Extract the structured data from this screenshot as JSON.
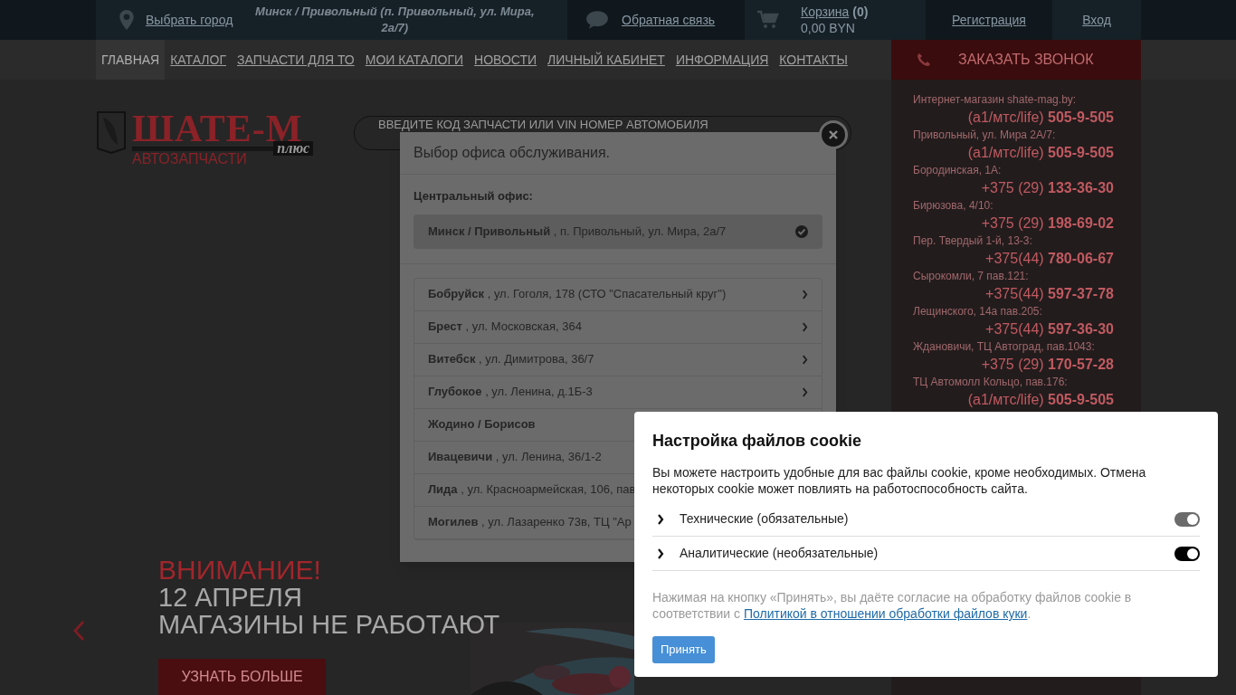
{
  "top_bar": {
    "city_link": "Выбрать город",
    "current_office": "Минск / Привольный (п. Привольный, ул. Мира, 2а/7)",
    "feedback_link": "Обратная связь",
    "cart": {
      "label": "Корзина",
      "count": "(0)",
      "total": "0,00 BYN"
    },
    "register_link": "Регистрация",
    "login_link": "Вход"
  },
  "nav": {
    "items": [
      {
        "label": "ГЛАВНАЯ",
        "selected": true
      },
      {
        "label": "КАТАЛОГ",
        "selected": false
      },
      {
        "label": "ЗАПЧАСТИ ДЛЯ ТО",
        "selected": false
      },
      {
        "label": "МОИ КАТАЛОГИ",
        "selected": false
      },
      {
        "label": "НОВОСТИ",
        "selected": false
      },
      {
        "label": "ЛИЧНЫЙ КАБИНЕТ",
        "selected": false
      },
      {
        "label": "ИНФОРМАЦИЯ",
        "selected": false
      },
      {
        "label": "КОНТАКТЫ",
        "selected": false
      }
    ],
    "callback_button": "ЗАКАЗАТЬ ЗВОНОК"
  },
  "logo": {
    "name": "ШАТЕ-М",
    "suffix": "плюс",
    "tagline": "АВТОЗАПЧАСТИ"
  },
  "search": {
    "placeholder": "ВВЕДИТЕ КОД ЗАПЧАСТИ ИЛИ VIN НОМЕР АВТОМОБИЛЯ"
  },
  "phones": [
    {
      "label": "Интернет-магазин shate-mag.by:",
      "prefix": "(а1/мтс/life)",
      "number": "505-9-505"
    },
    {
      "label": "Привольный, ул. Мира 2А/7:",
      "prefix": "(а1/мтс/life)",
      "number": "505-9-505"
    },
    {
      "label": "Бородинская, 1А:",
      "prefix": "+375 (29)",
      "number": "133-36-30"
    },
    {
      "label": "Бирюзова, 4/10:",
      "prefix": "+375 (29)",
      "number": "198-69-02"
    },
    {
      "label": "Пер. Твердый 1-й, 13-3:",
      "prefix": "+375(44)",
      "number": "780-06-67"
    },
    {
      "label": "Сырокомли, 7 пав.121:",
      "prefix": "+375(44)",
      "number": "597-37-78"
    },
    {
      "label": "Лещинского, 14а пав.205:",
      "prefix": "+375(44)",
      "number": "597-36-30"
    },
    {
      "label": "Ждановичи, ТЦ Автоград, пав.1043:",
      "prefix": "+375 (29)",
      "number": "170-57-28"
    },
    {
      "label": "ТЦ Автомолл Кольцо, пав.176:",
      "prefix": "(а1/мтс/life)",
      "number": "505-9-505"
    }
  ],
  "banner": {
    "title": "ВНИМАНИЕ!",
    "lines": [
      "12 АПРЕЛЯ",
      "МАГАЗИНЫ НЕ РАБОТАЮТ"
    ],
    "button": "УЗНАТЬ БОЛЬШЕ"
  },
  "office_modal": {
    "title": "Выбор офиса обслуживания.",
    "central_heading": "Центральный офис:",
    "central": [
      {
        "city": "Минск / Привольный",
        "address": ", п. Привольный, ул. Мира, 2а/7",
        "selected": true
      }
    ],
    "offices": [
      {
        "city": "Бобруйск",
        "address": ", ул. Гоголя, 178 (СТО \"Спасательный круг\")",
        "arrow": true
      },
      {
        "city": "Брест",
        "address": ", ул. Московская, 364",
        "arrow": true
      },
      {
        "city": "Витебск",
        "address": ", ул. Димитрова, 36/7",
        "arrow": true
      },
      {
        "city": "Глубокое",
        "address": ", ул. Ленина, д.1Б-3",
        "arrow": true
      },
      {
        "city": "Жодино / Борисов"
      },
      {
        "city": "Ивацевичи",
        "address": ", ул. Ленина, 36/1-2"
      },
      {
        "city": "Лида",
        "address": ", ул. Красноармейская, 106, пав"
      },
      {
        "city": "Могилев",
        "address": ", ул. Лазаренко 73в, ТЦ \"Ар"
      }
    ]
  },
  "cookie_dialog": {
    "title": "Настройка файлов cookie",
    "text": "Вы можете настроить удобные для вас файлы cookie, кроме необходимых. Отмена некоторых cookie может повлиять на работоспособность сайта.",
    "categories": [
      {
        "label": "Технические (обязательные)",
        "on": true,
        "disabled": true
      },
      {
        "label": "Аналитические (необязательные)",
        "on": true,
        "disabled": false
      }
    ],
    "consent": "Нажимая на кнопку «Принять», вы даёте согласие на обработку файлов cookie в соответствии с",
    "policy_link": "Политикой в отношении обработки файлов куки",
    "consent_end": ".",
    "button": "Принять"
  }
}
